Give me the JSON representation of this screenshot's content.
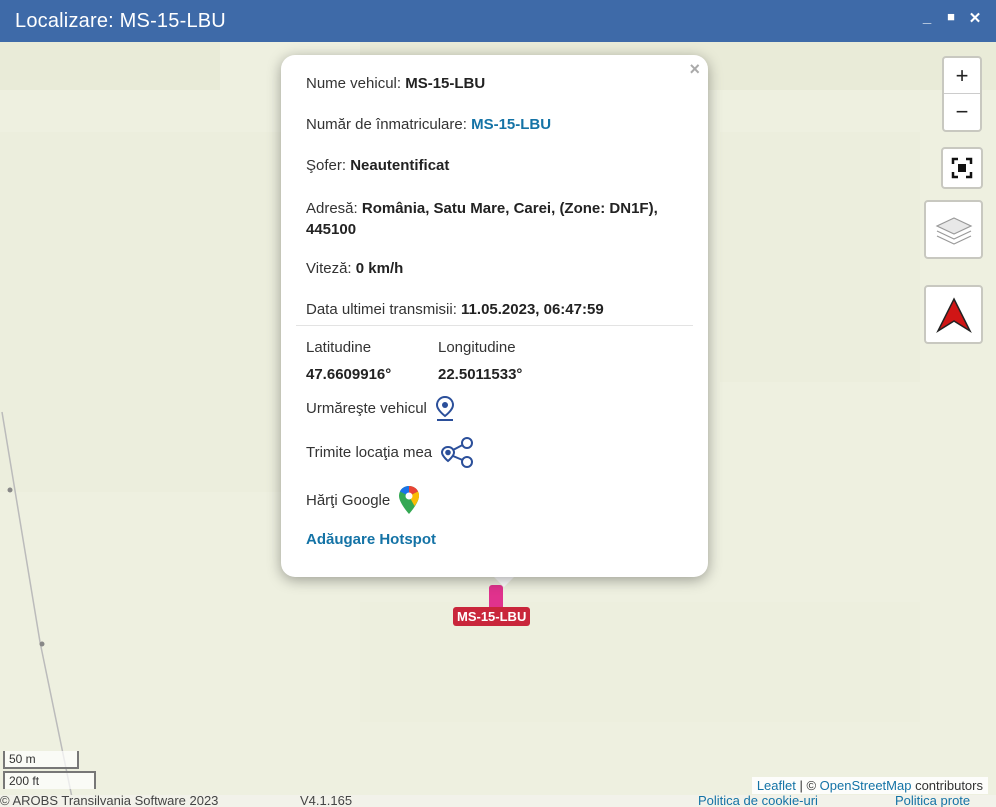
{
  "window": {
    "title": "Localizare: MS-15-LBU",
    "minimize": "_",
    "maximize": "■",
    "close": "✕"
  },
  "popup": {
    "close": "×",
    "vehicle_name_label": "Nume vehicul:",
    "vehicle_name": "MS-15-LBU",
    "plate_label": "Număr de înmatriculare:",
    "plate": "MS-15-LBU",
    "driver_label": "Şofer:",
    "driver": "Neautentificat",
    "address_label": "Adresă:",
    "address_line1": "România, Satu Mare, Carei, (Zone: DN1F),",
    "address_line2": "445100",
    "speed_label": "Viteză:",
    "speed": "0 km/h",
    "last_tx_label": "Data ultimei transmisii:",
    "last_tx": "11.05.2023, 06:47:59",
    "lat_label": "Latitudine",
    "lat": "47.6609916°",
    "lon_label": "Longitudine",
    "lon": "22.5011533°",
    "follow_label": "Urmăreşte vehicul",
    "share_label": "Trimite locaţia mea",
    "google_label": "Hărţi Google",
    "hotspot_label": "Adăugare Hotspot"
  },
  "marker": {
    "label": "MS-15-LBU"
  },
  "zoom": {
    "in": "+",
    "out": "−"
  },
  "scale": {
    "metric": "50 m",
    "imperial": "200 ft"
  },
  "attribution": {
    "leaflet": "Leaflet",
    "sep": " | © ",
    "osm": "OpenStreetMap",
    "contributors": " contributors"
  },
  "footer": {
    "copyright": "© AROBS Transilvania Software 2023",
    "version": "V4.1.165",
    "cookie": "Politica de cookie-uri",
    "privacy": "Politica prote"
  },
  "colors": {
    "titlebar": "#3e6aa8",
    "link": "#1473a6",
    "marker": "#e0328d",
    "marker_label": "#c9263b"
  },
  "icons": [
    "map-pin-icon",
    "share-location-icon",
    "google-maps-icon",
    "layers-icon",
    "fullscreen-icon",
    "north-arrow-icon"
  ]
}
